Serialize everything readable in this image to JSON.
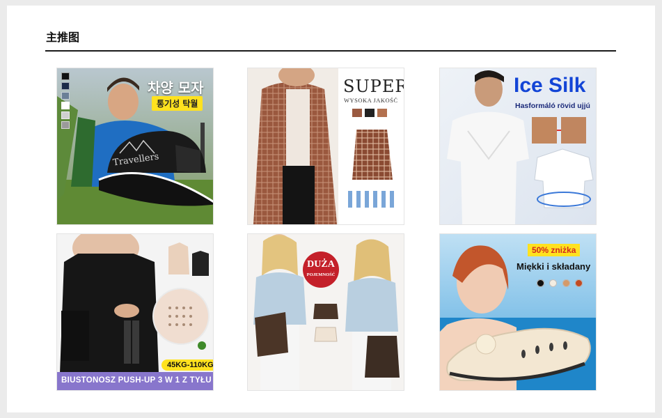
{
  "section": {
    "title": "主推图"
  },
  "cards": [
    {
      "title": "차양 모자",
      "badge": "통기성 탁월",
      "cap_text": "Travellers",
      "swatches": [
        "#111111",
        "#1c2a4a",
        "#6b7f97",
        "#ffffff",
        "#cfcfcf",
        "#9a9a9a"
      ]
    },
    {
      "title": "SUPER",
      "subtitle": "WYSOKA JAKOŚĆ"
    },
    {
      "title": "Ice Silk",
      "subtitle": "Hasformáló rövid ujjú"
    },
    {
      "badge": "45KG-110KG",
      "banner": "BIUSTONOSZ PUSH-UP 3 W 1 Z TYŁU"
    },
    {
      "badge_big": "DUŻA",
      "badge_small": "POJEMNOŚĆ"
    },
    {
      "badge": "50% zniżka",
      "text": "Miękki i składany",
      "colors": [
        "#111111",
        "#f3ede2",
        "#d49a6a",
        "#c24a22"
      ]
    }
  ],
  "colors": {
    "accent_yellow": "#ffe21f",
    "ice_blue": "#1345d6",
    "banner_purple": "#8876cc",
    "badge_red": "#c4202a"
  }
}
